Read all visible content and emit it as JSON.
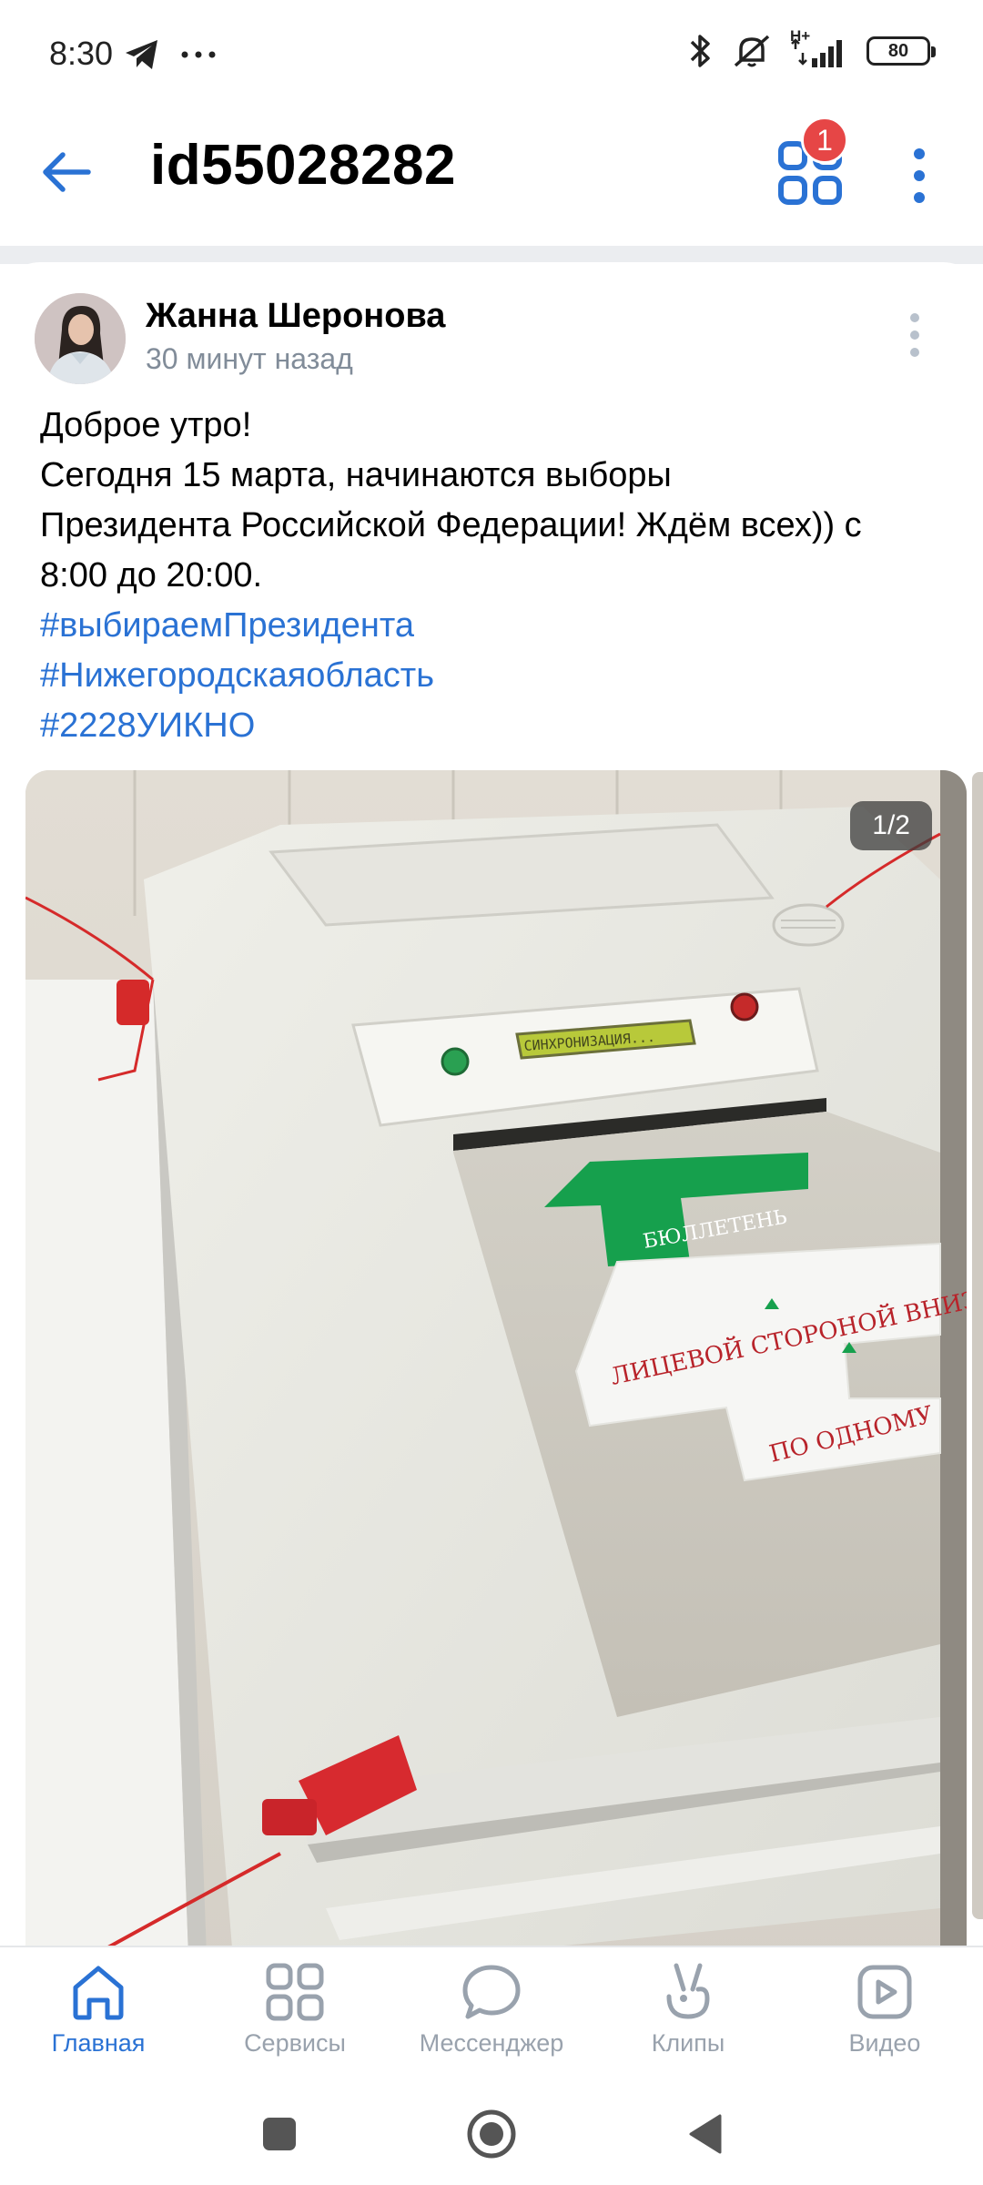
{
  "status_bar": {
    "time": "8:30",
    "battery": "80",
    "network": "H+"
  },
  "header": {
    "title": "id55028282",
    "badge_count": "1"
  },
  "post": {
    "author": "Жанна Шеронова",
    "time": "30 минут назад",
    "text_lines": [
      "Доброе утро!",
      "Сегодня 15 марта, начинаются выборы",
      "Президента Российской Федерации! Ждём всех)) с",
      "8:00 до 20:00."
    ],
    "hashtags": [
      "#выбираемПрезидента",
      "#Нижегородскаяобласть",
      "#2228УИКНО"
    ],
    "photo_counter": "1/2",
    "photo_texts": {
      "display": "СИНХРОНИЗАЦИЯ...",
      "arrow": "БЮЛЛЕТЕНЬ",
      "sticker_line1": "ЛИЦЕВОЙ СТОРОНОЙ ВНИЗ",
      "sticker_line2": "ПО ОДНОМУ"
    }
  },
  "tabs": [
    {
      "label": "Главная",
      "icon": "home-icon",
      "active": true
    },
    {
      "label": "Сервисы",
      "icon": "services-icon",
      "active": false
    },
    {
      "label": "Мессенджер",
      "icon": "messenger-icon",
      "active": false
    },
    {
      "label": "Клипы",
      "icon": "clips-icon",
      "active": false
    },
    {
      "label": "Видео",
      "icon": "video-icon",
      "active": false
    }
  ],
  "colors": {
    "accent": "#2a72d4",
    "badge": "#e64646",
    "secondary_text": "#818c99",
    "inactive_tab": "#99a2ad"
  }
}
